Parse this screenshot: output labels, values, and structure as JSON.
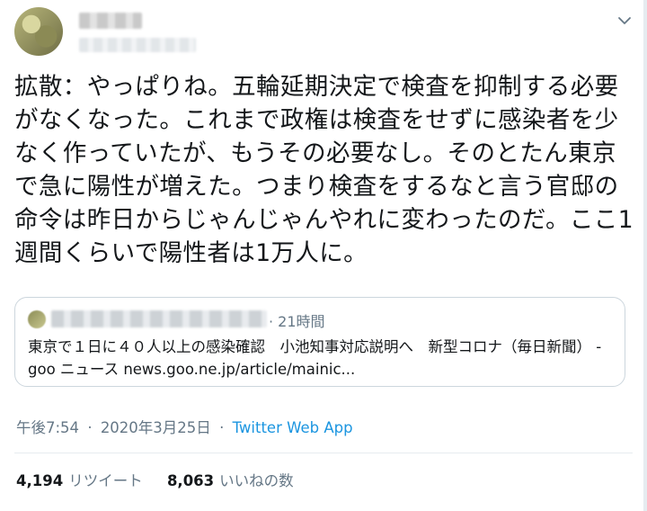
{
  "tweet": {
    "text": "拡散：やっぱりね。五輪延期決定で検査を抑制する必要がなくなった。これまで政権は検査をせずに感染者を少なく作っていたが、もうその必要なし。そのとたん東京で急に陽性が増えた。つまり検査をするなと言う官邸の命令は昨日からじゃんじゃんやれに変わったのだ。ここ1週間くらいで陽性者は1万人に。"
  },
  "quoted": {
    "time": "· 21時間",
    "text": "東京で１日に４０人以上の感染確認　小池知事対応説明へ　新型コロナ（毎日新聞） - goo ニュース  news.goo.ne.jp/article/mainic..."
  },
  "meta": {
    "time": "午後7:54",
    "sep1": "·",
    "date": "2020年3月25日",
    "sep2": "·",
    "app": "Twitter Web App"
  },
  "stats": {
    "retweets": "4,194",
    "retweets_label": "リツイート",
    "likes": "8,063",
    "likes_label": "いいねの数"
  },
  "icons": {
    "menu": "chevron-down-icon"
  }
}
